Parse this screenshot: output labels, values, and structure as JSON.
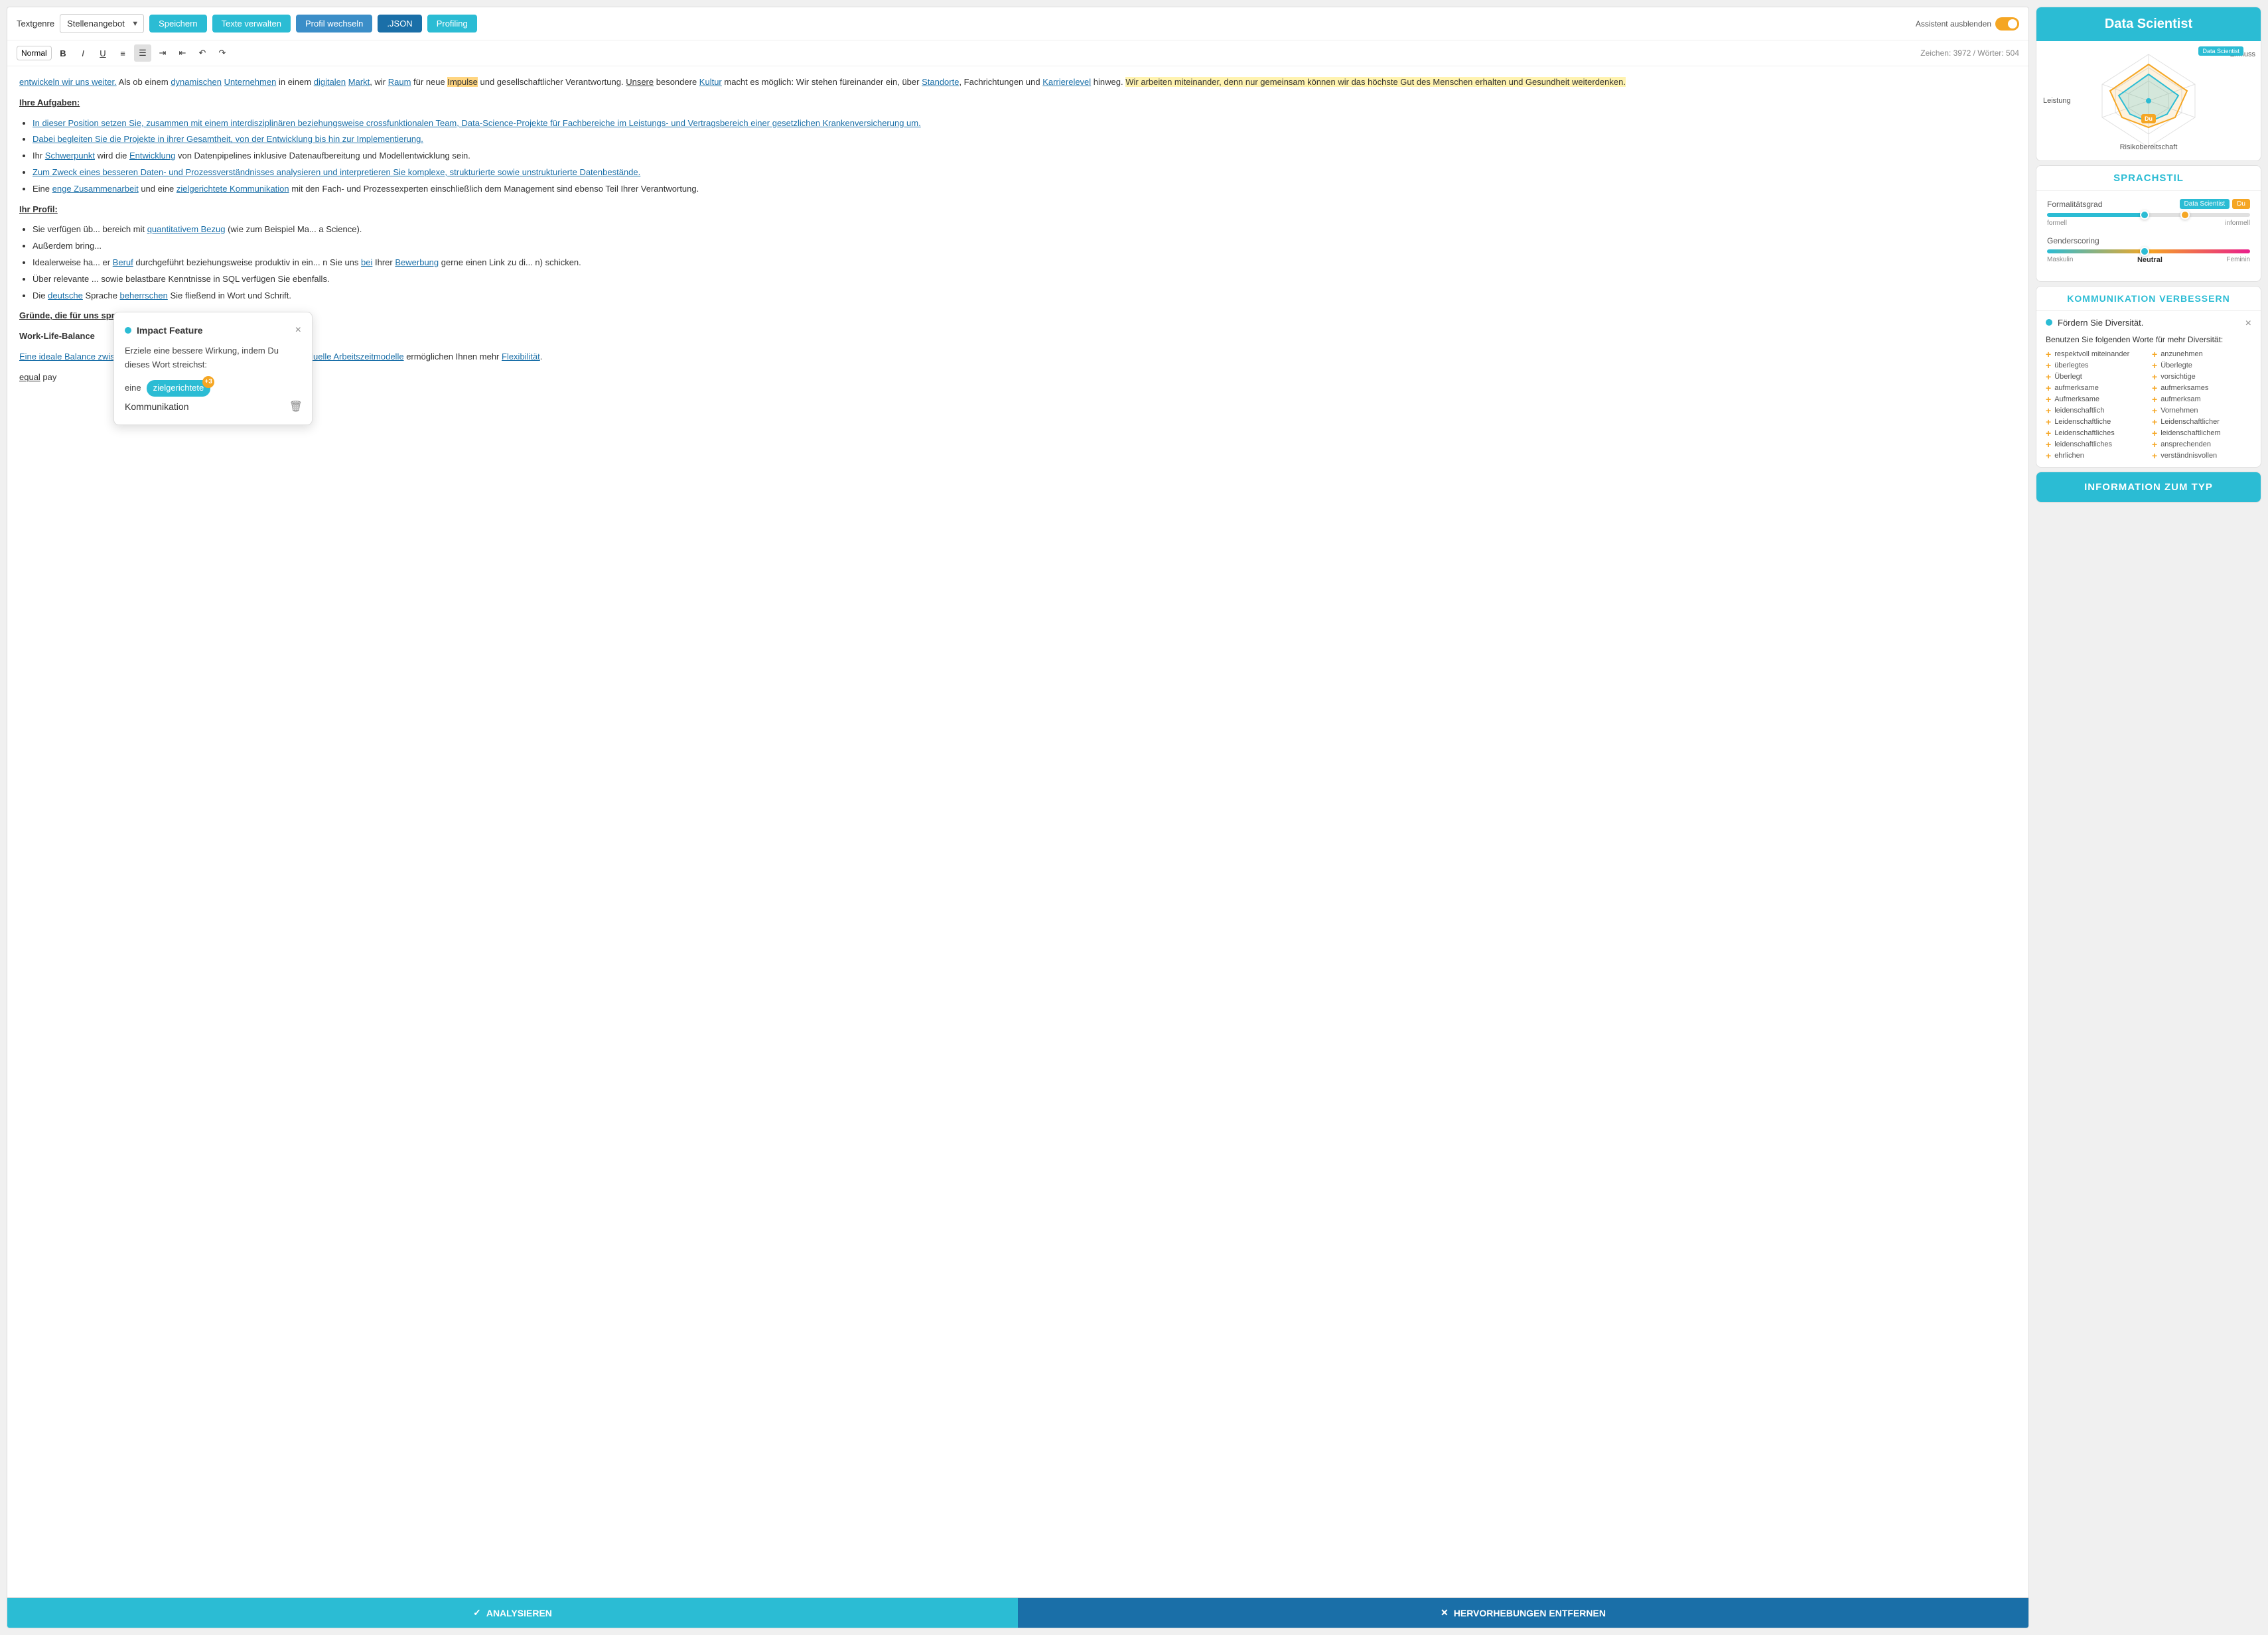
{
  "toolbar": {
    "textgenre_label": "Textgenre",
    "textgenre_value": "Stellenangebot",
    "save_label": "Speichern",
    "manage_texts_label": "Texte verwalten",
    "switch_profile_label": "Profil wechseln",
    "json_label": ".JSON",
    "profiling_label": "Profiling",
    "assistant_toggle_label": "Assistent ausblenden"
  },
  "format_toolbar": {
    "style_value": "Normal",
    "char_count": "Zeichen: 3972 / Wörter: 504"
  },
  "editor": {
    "text_blocks": [
      "entwickeln wir uns weiter. Als ob einem dynamischen Unternehmen in einem digitalen Markt, wir Raum für neue Impulse und gesellschaftlicher Verantwortung. Unsere besondere Kultur macht es möglich: Wir stehen füreinander ein, über Standorte, Fachrichtungen und Karrierelevel hinweg. Wir arbeiten miteinander, denn nur gemeinsam können wir das höchste Gut des Menschen erhalten und Gesundheit weiterdenken.",
      "Ihre Aufgaben:",
      "In dieser Position setzen Sie, zusammen mit einem interdisziplinären beziehungsweise crossfunktionalen Team, Data-Science-Projekte für Fachbereiche im Leistungs- und Vertragsbereich einer gesetzlichen Krankenversicherung um.",
      "Dabei begleiten Sie die Projekte in ihrer Gesamtheit, von der Entwicklung bis hin zur Implementierung.",
      "Ihr Schwerpunkt wird die Entwicklung von Datenpipelines inklusive Datenaufbereitung und Modellentwicklung sein.",
      "Zum Zweck eines besseren Daten- und Prozessverständnisses analysieren und interpretieren Sie komplexe, strukturierte sowie unstrukturierte Datenbestände.",
      "Eine enge Zusammenarbeit und eine zielgerichtete Kommunikation mit den Fach- und Prozessexperten einschließlich dem Management sind ebenso Teil Ihrer Verantwortung.",
      "Ihr Profil:",
      "Sie verfügen üb... bereich mit quantitativem Bezug (wie zum Beispiel Ma... a Science).",
      "Außerdem bring...",
      "Idealerweise ha... er Beruf durchgeführt beziehungsweise produktiv in ein... n Sie uns bei Ihrer Bewerbung gerne einen Link zu di... n) schicken.",
      "Über relevante ... sowie belastbare Kenntnisse in SQL verfügen Sie ebenfalls.",
      "Die deutsche Sprache beherrschen Sie fließend in Wort und Schrift.",
      "Gründe, die für uns sprechen",
      "Work-Life-Balance",
      "Eine ideale Balance zwischen Beruf und Privatleben ist bei uns Alltag. Individuelle Arbeitszeitmodelle ermöglichen Ihnen mehr Flexibilität.",
      "equal pay"
    ]
  },
  "popup": {
    "title": "Impact Feature",
    "description": "Erziele eine bessere Wirkung, indem Du dieses Wort streichst:",
    "word_before": "eine",
    "word_chip": "zielgerichtete",
    "word_badge": "+3",
    "word_after": "Kommunikation",
    "close_label": "×",
    "trash_label": "🗑"
  },
  "bottom_bar": {
    "analyze_label": "ANALYSIEREN",
    "remove_highlights_label": "HERVORHEBUNGEN ENTFERNEN"
  },
  "right_panel": {
    "profile_title": "Data Scientist",
    "radar_labels": {
      "top_right": "Einfluss",
      "left": "Leistung",
      "bottom": "Risikobereitschaft"
    },
    "radar_badge": "Data Scientist",
    "du_badge": "Du",
    "sprachstil_header": "SPRACHSTIL",
    "formalitaet_label": "Formalitätsgrad",
    "formalitaet_badge1": "Data Scientist",
    "formalitaet_badge2": "Du",
    "slider_left": "formell",
    "slider_right": "informell",
    "genderscoring_label": "Genderscoring",
    "gender_left": "Maskulin",
    "gender_neutral": "Neutral",
    "gender_right": "Feminin",
    "kommunikation_header": "KOMMUNIKATION VERBESSERN",
    "kommunikation_tip": "Fördern Sie Diversität.",
    "kommunikation_subtitle": "Benutzen Sie folgenden Worte für mehr Diversität:",
    "words_left": [
      "respektvoll miteinander",
      "überlegtes",
      "Überlegt",
      "aufmerksame",
      "Aufmerksame",
      "leidenschaftlich",
      "Leidenschaftliche",
      "Leidenschaftliches",
      "leidenschaftliches",
      "ehrlichen"
    ],
    "words_right": [
      "anzunehmen",
      "Überlegte",
      "vorsichtige",
      "aufmerksames",
      "aufmerksam",
      "Vornehmen",
      "Leidenschaftlicher",
      "leidenschaftlichem",
      "ansprechenden",
      "verständnisvollen"
    ],
    "info_header": "INFORMATION ZUM TYP"
  }
}
